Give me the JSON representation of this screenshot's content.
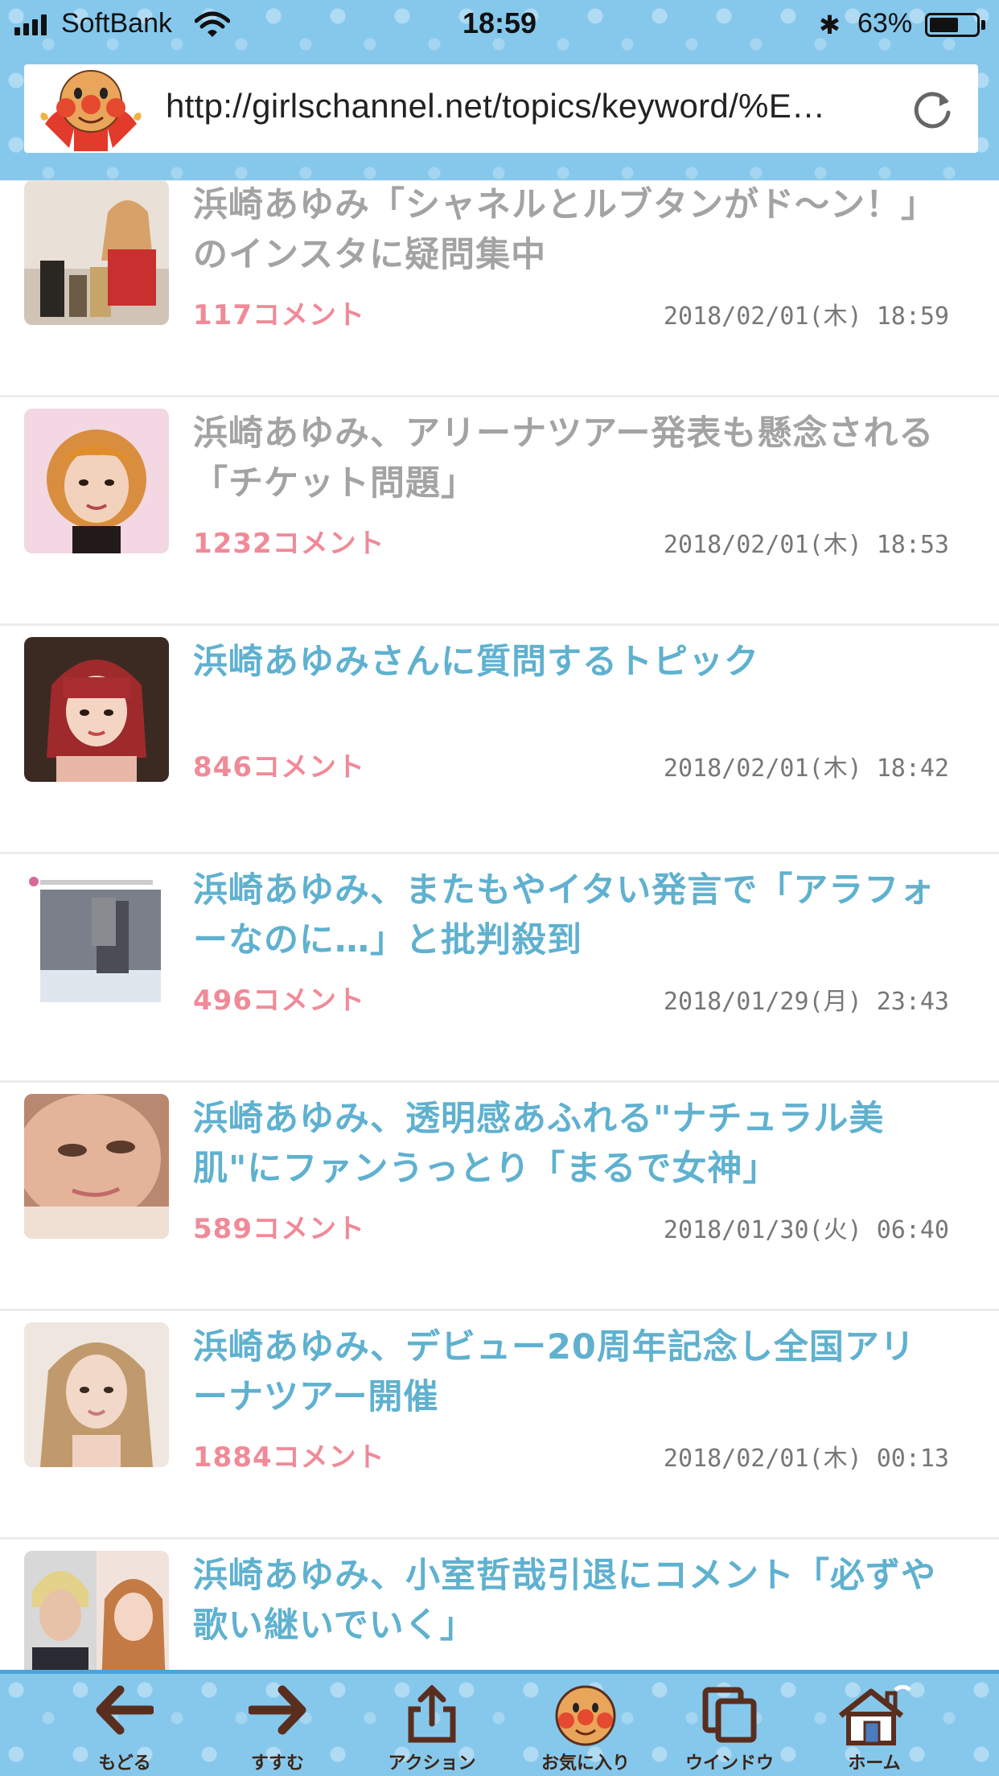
{
  "status_bar": {
    "carrier": "SoftBank",
    "time": "18:59",
    "battery_percent": "63%",
    "battery_level": 0.63
  },
  "address_bar": {
    "url": "http://girlschannel.net/topics/keyword/%E…",
    "reload_icon": "reload-icon"
  },
  "topics": [
    {
      "title": "浜崎あゆみ「シャネルとルブタンがド〜ン！」のインスタに疑問集中",
      "comments": "117コメント",
      "date": "2018/02/01(木) 18:59",
      "visited": true
    },
    {
      "title": "浜崎あゆみ、アリーナツアー発表も懸念される「チケット問題」",
      "comments": "1232コメント",
      "date": "2018/02/01(木) 18:53",
      "visited": true
    },
    {
      "title": "浜崎あゆみさんに質問するトピック",
      "comments": "846コメント",
      "date": "2018/02/01(木) 18:42",
      "visited": false
    },
    {
      "title": "浜崎あゆみ、またもやイタい発言で「アラフォーなのに…」と批判殺到",
      "comments": "496コメント",
      "date": "2018/01/29(月) 23:43",
      "visited": false
    },
    {
      "title": "浜崎あゆみ、透明感あふれる\"ナチュラル美肌\"にファンうっとり「まるで女神」",
      "comments": "589コメント",
      "date": "2018/01/30(火) 06:40",
      "visited": false
    },
    {
      "title": "浜崎あゆみ、デビュー20周年記念し全国アリーナツアー開催",
      "comments": "1884コメント",
      "date": "2018/02/01(木) 00:13",
      "visited": false
    },
    {
      "title": "浜崎あゆみ、小室哲哉引退にコメント「必ずや歌い継いでいく」",
      "comments": "",
      "date": "",
      "visited": false
    }
  ],
  "toolbar": {
    "back": "もどる",
    "forward": "すすむ",
    "action": "アクション",
    "favorites": "お気に入り",
    "window": "ウインドウ",
    "home": "ホーム"
  },
  "colors": {
    "header_bg": "#86c8ec",
    "title_visited": "#a3a3a3",
    "title_fresh": "#5fb1cf",
    "comment_count": "#f08a98",
    "toolbar_icon": "#5a2e1e"
  }
}
